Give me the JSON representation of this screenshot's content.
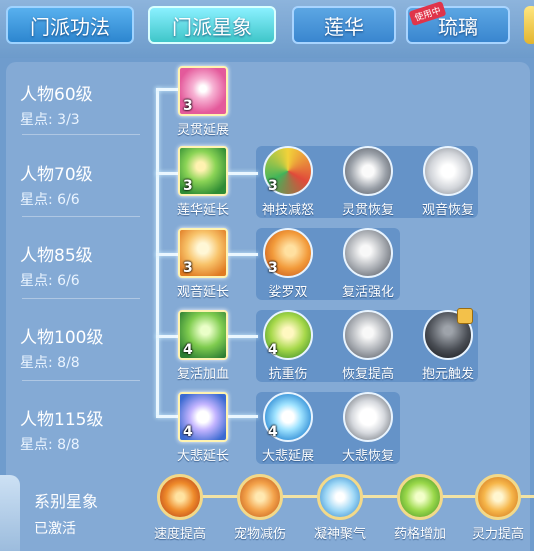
{
  "tabs": [
    {
      "label": "门派功法",
      "style": "blue"
    },
    {
      "label": "门派星象",
      "style": "green",
      "selected": true
    },
    {
      "label": "莲华",
      "style": "dim"
    },
    {
      "label": "琉璃",
      "style": "dim",
      "badge": "使用中"
    }
  ],
  "levels": [
    {
      "name": "人物60级",
      "points": "星点: 3/3"
    },
    {
      "name": "人物70级",
      "points": "星点: 6/6"
    },
    {
      "name": "人物85级",
      "points": "星点: 6/6"
    },
    {
      "name": "人物100级",
      "points": "星点: 8/8"
    },
    {
      "name": "人物115级",
      "points": "星点: 8/8"
    }
  ],
  "rows": [
    {
      "nodes": [
        {
          "label": "灵贯延展",
          "count": "3",
          "icon": "lotus-light-icon",
          "color": "#f06aa8"
        }
      ]
    },
    {
      "nodes": [
        {
          "label": "莲华延长",
          "count": "3",
          "icon": "hand-leaf-icon",
          "color": "#4fb84a"
        },
        {
          "label": "神技减怒",
          "count": "3",
          "icon": "target-rainbow-icon",
          "color": "#e9c23a"
        },
        {
          "label": "灵贯恢复",
          "count": "",
          "icon": "lotus-grey-icon",
          "color": "#9aa0a8"
        },
        {
          "label": "观音恢复",
          "count": "",
          "icon": "guanyin-grey-icon",
          "color": "#c2c6cc"
        }
      ]
    },
    {
      "nodes": [
        {
          "label": "观音延长",
          "count": "3",
          "icon": "guanyin-gold-icon",
          "color": "#f3a43b"
        },
        {
          "label": "娑罗双",
          "count": "3",
          "icon": "hand-flame-icon",
          "color": "#f08a2f"
        },
        {
          "label": "复活强化",
          "count": "",
          "icon": "wing-grey-icon",
          "color": "#9aa0a8"
        }
      ]
    },
    {
      "nodes": [
        {
          "label": "复活加血",
          "count": "4",
          "icon": "hand-bamboo-icon",
          "color": "#58b84b"
        },
        {
          "label": "抗重伤",
          "count": "4",
          "icon": "hand-glow-icon",
          "color": "#8ccc3e"
        },
        {
          "label": "恢复提高",
          "count": "",
          "icon": "hand-grey-icon",
          "color": "#a4a8ae"
        },
        {
          "label": "抱元触发",
          "count": "",
          "icon": "meditate-dark-icon",
          "color": "#50545a",
          "locked": true
        }
      ]
    },
    {
      "nodes": [
        {
          "label": "大悲延长",
          "count": "4",
          "icon": "orb-purple-icon",
          "color": "#7f6bdc"
        },
        {
          "label": "大悲延展",
          "count": "4",
          "icon": "orb-blue-icon",
          "color": "#3fa6e6"
        },
        {
          "label": "大悲恢复",
          "count": "",
          "icon": "orb-white-icon",
          "color": "#c9ccd0"
        }
      ]
    }
  ],
  "system": {
    "name": "系别星象",
    "state": "已激活",
    "items": [
      {
        "label": "速度提高",
        "icon": "flame-swirl-icon",
        "color": "#e8731f"
      },
      {
        "label": "宠物减伤",
        "icon": "hand-orange-icon",
        "color": "#f08c2c"
      },
      {
        "label": "凝神聚气",
        "icon": "figure-sparkle-icon",
        "color": "#5bb0e6"
      },
      {
        "label": "药格增加",
        "icon": "green-gem-icon",
        "color": "#7dc43b"
      },
      {
        "label": "灵力提高",
        "icon": "spark-burst-icon",
        "color": "#f3a83a"
      }
    ]
  }
}
